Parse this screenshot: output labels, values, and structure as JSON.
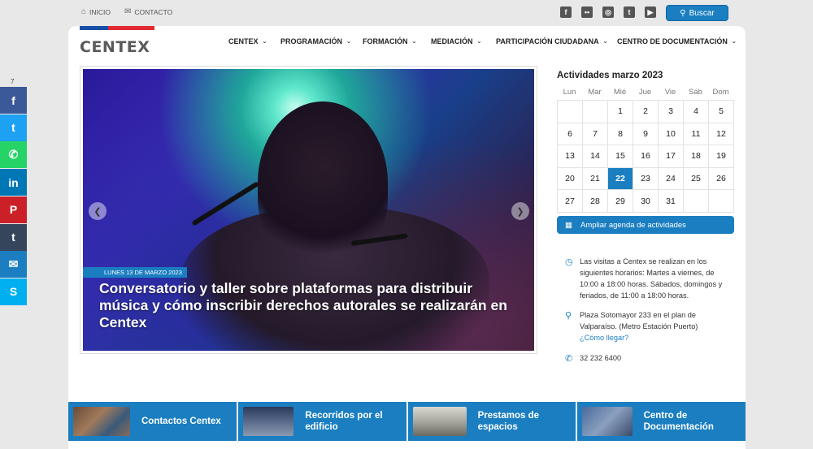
{
  "top_links": [
    {
      "label": "INICIO",
      "icon": "home-icon"
    },
    {
      "label": "CONTACTO",
      "icon": "envelope-icon"
    }
  ],
  "social": [
    "facebook-icon",
    "flickr-icon",
    "instagram-icon",
    "twitter-icon",
    "youtube-icon"
  ],
  "search_label": "Buscar",
  "logo_text": "CENTEX",
  "nav": [
    "CENTEX",
    "PROGRAMACIÓN",
    "FORMACIÓN",
    "MEDIACIÓN",
    "PARTICIPACIÓN CIUDADANA",
    "CENTRO DE DOCUMENTACIÓN"
  ],
  "slide": {
    "date": "LUNES 13 DE MARZO 2023",
    "title": "Conversatorio y taller sobre plataformas para distribuir música y cómo inscribir derechos autorales se realizarán en Centex"
  },
  "calendar": {
    "title": "Actividades marzo 2023",
    "weekdays": [
      "Lun",
      "Mar",
      "Mié",
      "Jue",
      "Vie",
      "Sáb",
      "Dom"
    ],
    "leading_blanks": 2,
    "days": 31,
    "today": 22
  },
  "agenda_label": "Ampliar agenda de actividades",
  "info": {
    "hours": "Las visitas a Centex se realizan en los siguientes horarios: Martes a viernes, de 10:00 a 18:00 horas. Sábados, domingos y feriados, de 11:00 a 18:00 horas.",
    "address": "Plaza Sotomayor 233 en el plan de Valparaíso. (Metro Estación Puerto)",
    "directions_link": "¿Cómo llegar?",
    "phone": "32 232 6400"
  },
  "boxes": [
    {
      "label": "Contactos Centex"
    },
    {
      "label": "Recorridos por el edificio"
    },
    {
      "label": "Prestamos de espacios"
    },
    {
      "label": "Centro de Documentación"
    }
  ],
  "share": {
    "count": "7",
    "items": [
      {
        "icon": "facebook-icon",
        "glyph": "f",
        "color": "#3b5998"
      },
      {
        "icon": "twitter-icon",
        "glyph": "t",
        "color": "#1da1f2"
      },
      {
        "icon": "whatsapp-icon",
        "glyph": "✆",
        "color": "#25d366"
      },
      {
        "icon": "linkedin-icon",
        "glyph": "in",
        "color": "#0077b5"
      },
      {
        "icon": "pinterest-icon",
        "glyph": "P",
        "color": "#cb2027"
      },
      {
        "icon": "tumblr-icon",
        "glyph": "t",
        "color": "#35465c"
      },
      {
        "icon": "email-icon",
        "glyph": "✉",
        "color": "#1a7ec0"
      },
      {
        "icon": "skype-icon",
        "glyph": "S",
        "color": "#00aff0"
      }
    ]
  }
}
